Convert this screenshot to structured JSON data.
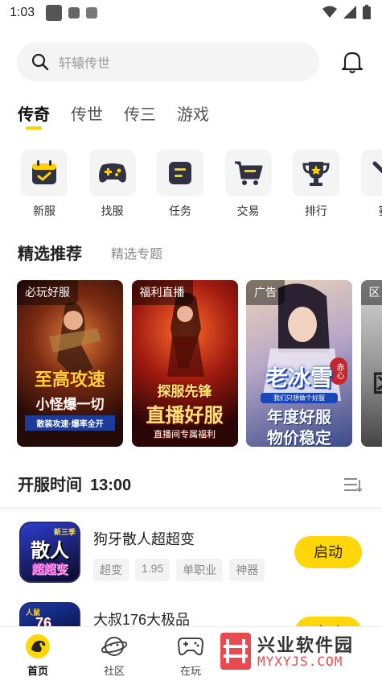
{
  "status_bar": {
    "time": "1:03"
  },
  "search": {
    "placeholder": "轩辕传世"
  },
  "tabs": [
    {
      "label": "传奇",
      "active": true
    },
    {
      "label": "传世",
      "active": false
    },
    {
      "label": "传三",
      "active": false
    },
    {
      "label": "游戏",
      "active": false
    }
  ],
  "categories": [
    {
      "label": "新服",
      "icon": "calendar-check-icon"
    },
    {
      "label": "找服",
      "icon": "gamepad-icon"
    },
    {
      "label": "任务",
      "icon": "task-list-icon"
    },
    {
      "label": "交易",
      "icon": "cart-icon"
    },
    {
      "label": "排行",
      "icon": "trophy-icon"
    },
    {
      "label": "赛",
      "icon": "sword-icon"
    }
  ],
  "featured": {
    "title": "精选推荐",
    "subtitle": "精选专题",
    "banners": [
      {
        "tag": "必玩好服",
        "headline": "至高攻速",
        "line2": "小怪爆一切",
        "line3": "散装攻速·爆率全开"
      },
      {
        "tag": "福利直播",
        "headline": "探服先锋",
        "line2": "直播好服",
        "line3": "直播间专属福利"
      },
      {
        "tag": "广告",
        "headline": "老冰雪",
        "line2": "年度好服",
        "line3": "物价稳定",
        "badge": "赤心",
        "caption": "我们只想做个好服"
      },
      {
        "tag": "区",
        "headline": "区",
        "line2": ""
      }
    ]
  },
  "open_time": {
    "label": "开服时间",
    "time": "13:00"
  },
  "games": [
    {
      "name": "狗牙散人超超变",
      "tags": [
        "超变",
        "1.95",
        "单职业",
        "神器"
      ],
      "button": "启动",
      "thumb_text": "散人",
      "thumb_sub": "超超变",
      "thumb_badge": "新三季"
    },
    {
      "name": "大叔176大极品",
      "tags": [],
      "button": "启动",
      "thumb_text": "76",
      "thumb_sub": "人鼠"
    }
  ],
  "bottom_nav": [
    {
      "label": "首页",
      "icon": "home-dragon-icon",
      "active": true
    },
    {
      "label": "社区",
      "icon": "planet-icon",
      "active": false
    },
    {
      "label": "在玩",
      "icon": "gamepad-icon",
      "active": false
    }
  ],
  "watermark": {
    "title": "兴业软件园",
    "url": "MYXYJS.COM"
  },
  "colors": {
    "accent": "#ffd60a",
    "watermark_red": "#e84a4f"
  }
}
